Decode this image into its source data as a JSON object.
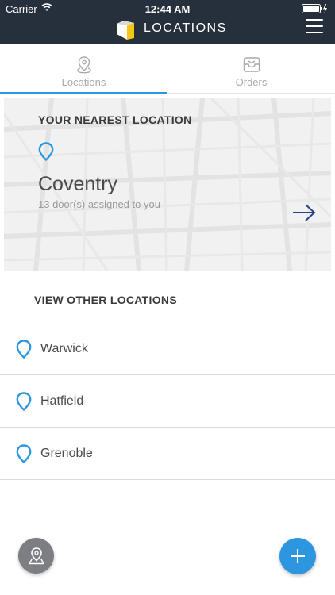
{
  "status_bar": {
    "carrier": "Carrier",
    "time": "12:44 AM"
  },
  "header": {
    "title": "LOCATIONS",
    "background": "#26303c",
    "logo_color": "#f5c518"
  },
  "tabs": [
    {
      "label": "Locations",
      "icon": "map-pin-outline-icon",
      "active": true
    },
    {
      "label": "Orders",
      "icon": "inbox-tray-icon",
      "active": false
    }
  ],
  "nearest": {
    "heading": "YOUR NEAREST LOCATION",
    "name": "Coventry",
    "subtitle": "13 door(s) assigned to you",
    "icons": [
      "map-pin-icon",
      "arrow-right-icon"
    ]
  },
  "other": {
    "heading": "VIEW OTHER LOCATIONS",
    "items": [
      {
        "name": "Warwick"
      },
      {
        "name": "Hatfield"
      },
      {
        "name": "Grenoble"
      }
    ]
  },
  "floating_buttons": {
    "left_icon": "map-marker-icon",
    "right_icon": "plus-icon"
  },
  "colors": {
    "accent": "#2c97de",
    "arrow": "#2a3f8f",
    "text_dark": "#3a3a3a",
    "text_muted": "#9a9a9a"
  }
}
